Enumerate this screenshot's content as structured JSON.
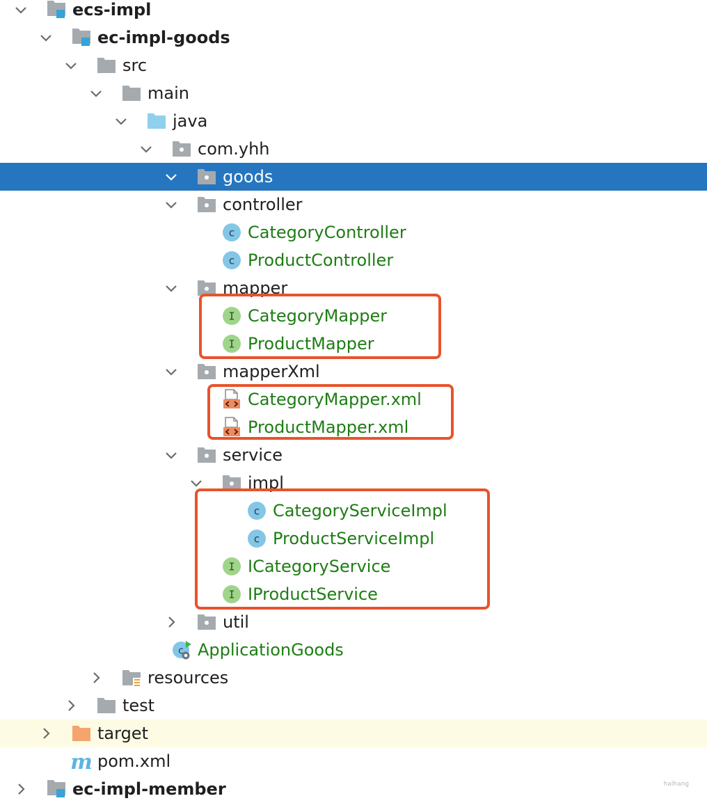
{
  "colors": {
    "selection": "#2675bf",
    "green_text": "#1e7d14",
    "excluded_bg": "#fdfbe3",
    "highlight_box": "#e8532b",
    "class_icon": "#84c6e6",
    "interface_icon": "#9fd58a",
    "folder_gray": "#a5aaaf",
    "source_folder": "#8fd0ec",
    "excluded_folder": "#f4a46d"
  },
  "tree": {
    "items": [
      {
        "label": "ecs-impl",
        "icon": "module-folder-icon",
        "chevron": "expanded",
        "bold": true
      },
      {
        "label": "ec-impl-goods",
        "icon": "module-folder-icon",
        "chevron": "expanded",
        "bold": true
      },
      {
        "label": "src",
        "icon": "folder-icon",
        "chevron": "expanded"
      },
      {
        "label": "main",
        "icon": "folder-icon",
        "chevron": "expanded"
      },
      {
        "label": "java",
        "icon": "source-folder-icon",
        "chevron": "expanded"
      },
      {
        "label": "com.yhh",
        "icon": "package-icon",
        "chevron": "expanded"
      },
      {
        "label": "goods",
        "icon": "package-icon",
        "chevron": "expanded",
        "selected": true
      },
      {
        "label": "controller",
        "icon": "package-icon",
        "chevron": "expanded"
      },
      {
        "label": "CategoryController",
        "icon": "class-icon"
      },
      {
        "label": "ProductController",
        "icon": "class-icon"
      },
      {
        "label": "mapper",
        "icon": "package-icon",
        "chevron": "expanded"
      },
      {
        "label": "CategoryMapper",
        "icon": "interface-icon"
      },
      {
        "label": "ProductMapper",
        "icon": "interface-icon"
      },
      {
        "label": "mapperXml",
        "icon": "package-icon",
        "chevron": "expanded"
      },
      {
        "label": "CategoryMapper.xml",
        "icon": "xml-file-icon"
      },
      {
        "label": "ProductMapper.xml",
        "icon": "xml-file-icon"
      },
      {
        "label": "service",
        "icon": "package-icon",
        "chevron": "expanded"
      },
      {
        "label": "impl",
        "icon": "package-icon",
        "chevron": "expanded"
      },
      {
        "label": "CategoryServiceImpl",
        "icon": "class-icon"
      },
      {
        "label": "ProductServiceImpl",
        "icon": "class-icon"
      },
      {
        "label": "ICategoryService",
        "icon": "interface-icon"
      },
      {
        "label": "IProductService",
        "icon": "interface-icon"
      },
      {
        "label": "util",
        "icon": "package-icon",
        "chevron": "collapsed"
      },
      {
        "label": "ApplicationGoods",
        "icon": "spring-boot-class-icon"
      },
      {
        "label": "resources",
        "icon": "resources-folder-icon",
        "chevron": "collapsed"
      },
      {
        "label": "test",
        "icon": "folder-icon",
        "chevron": "collapsed"
      },
      {
        "label": "target",
        "icon": "excluded-folder-icon",
        "chevron": "collapsed",
        "excluded": true
      },
      {
        "label": "pom.xml",
        "icon": "maven-icon"
      },
      {
        "label": "ec-impl-member",
        "icon": "module-folder-icon",
        "chevron": "collapsed",
        "bold": true
      }
    ]
  },
  "watermark": "haihang"
}
